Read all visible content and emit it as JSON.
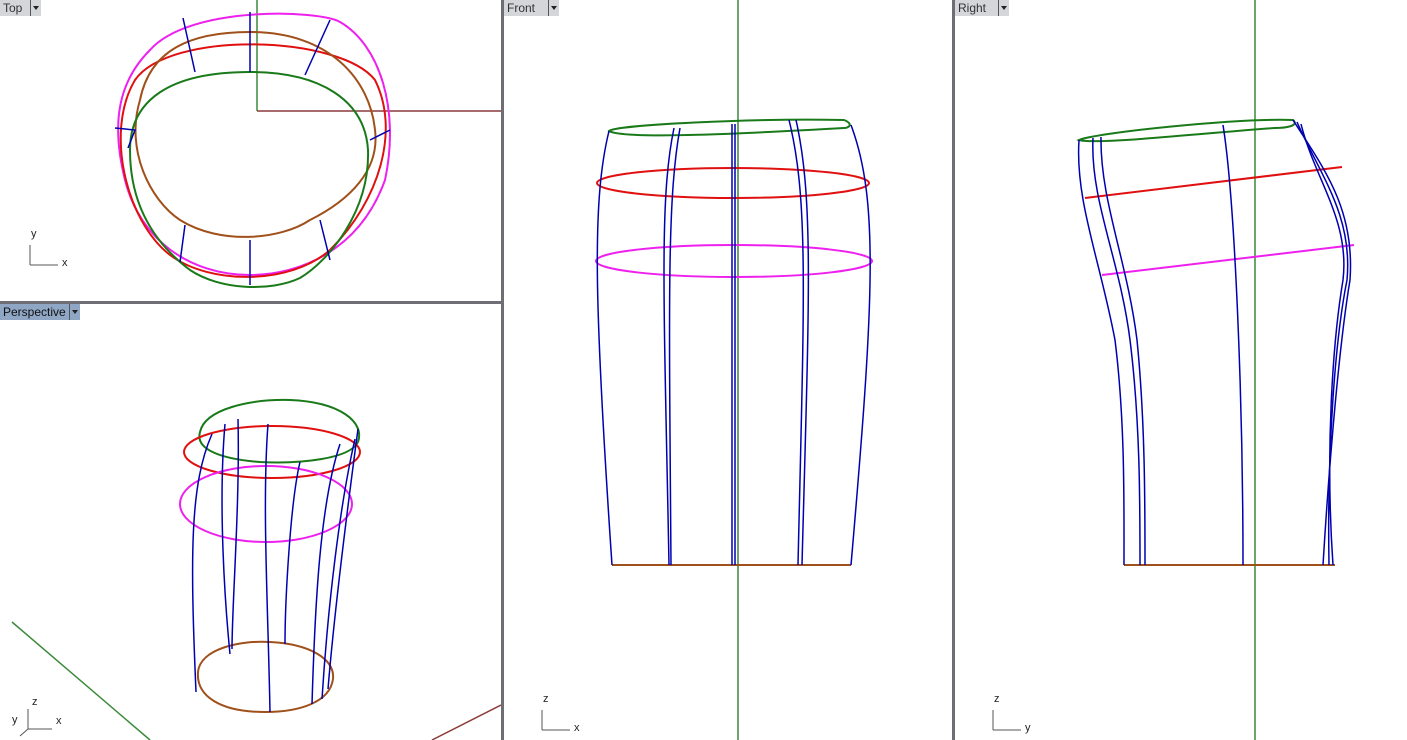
{
  "viewports": {
    "top": {
      "label": "Top",
      "axis_h": "x",
      "axis_v": "y"
    },
    "perspective": {
      "label": "Perspective",
      "axis_x": "x",
      "axis_y": "y",
      "axis_z": "z"
    },
    "front": {
      "label": "Front",
      "axis_h": "x",
      "axis_v": "z"
    },
    "right": {
      "label": "Right",
      "axis_h": "y",
      "axis_v": "z"
    }
  },
  "colors": {
    "blue": "#0000b0",
    "green": "#1a7a1a",
    "red": "#e01010",
    "magenta": "#ee20ee",
    "brown": "#a0501a",
    "axis_green": "#3a8a3a",
    "axis_red": "#8a3a3a",
    "active": "#8fa6c4"
  }
}
